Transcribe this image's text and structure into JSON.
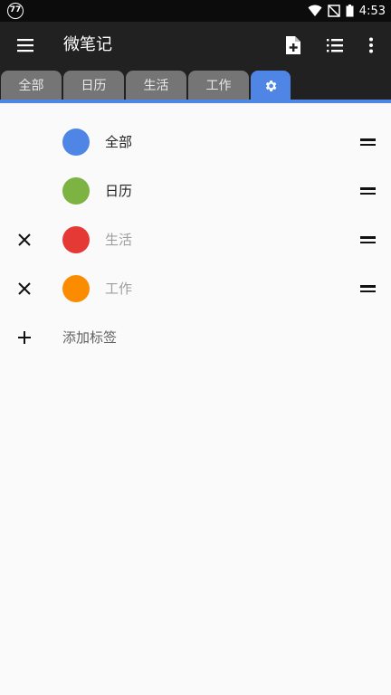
{
  "status_bar": {
    "notification_badge": "77",
    "time": "4:53",
    "icons": [
      "wifi-icon",
      "no-signal-icon",
      "battery-icon"
    ]
  },
  "app_bar": {
    "title": "微笔记",
    "icons": [
      "menu-icon",
      "new-note-icon",
      "list-view-icon",
      "more-vert-icon"
    ]
  },
  "tabs": [
    {
      "label": "全部"
    },
    {
      "label": "日历"
    },
    {
      "label": "生活"
    },
    {
      "label": "工作"
    }
  ],
  "settings_tab_icon": "gear-icon",
  "tag_list": [
    {
      "label": "全部",
      "color": "#4f86e6",
      "enabled": true,
      "removable": false
    },
    {
      "label": "日历",
      "color": "#7cb342",
      "enabled": true,
      "removable": false
    },
    {
      "label": "生活",
      "color": "#e53935",
      "enabled": false,
      "removable": true
    },
    {
      "label": "工作",
      "color": "#fb8c00",
      "enabled": false,
      "removable": true
    }
  ],
  "add_tag": {
    "label": "添加标签"
  },
  "colors": {
    "accent": "#4f86e6",
    "app_bar": "#212121",
    "tab_inactive": "#757575"
  }
}
